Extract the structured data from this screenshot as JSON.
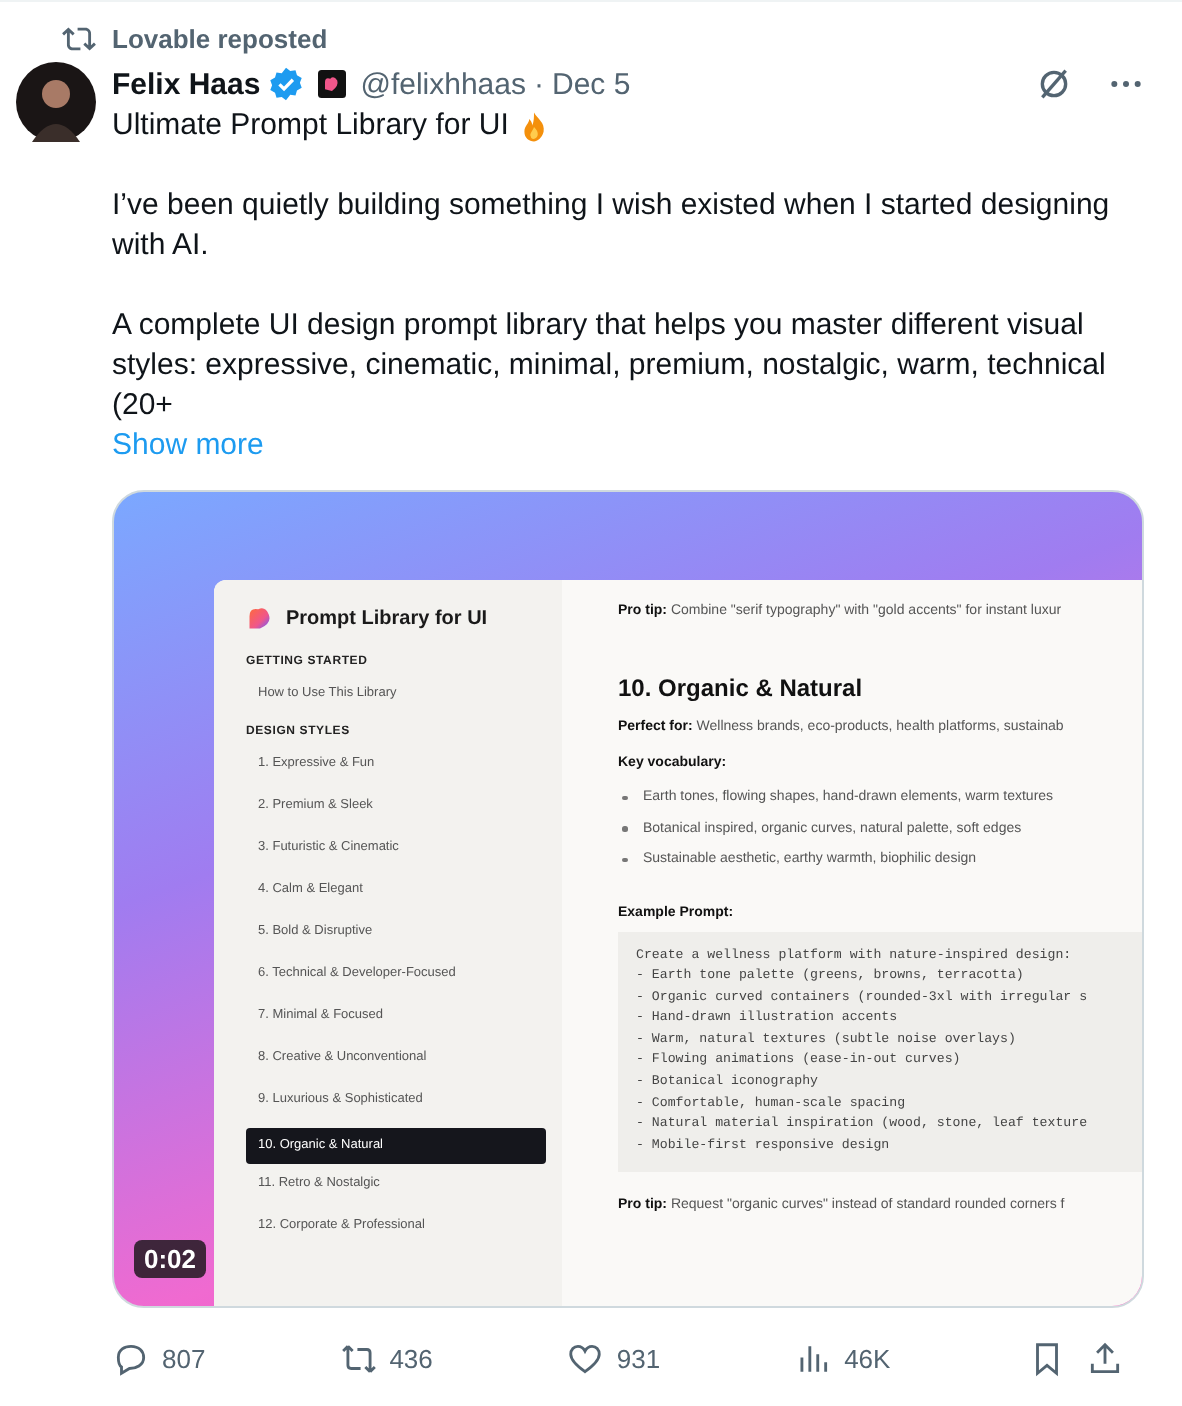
{
  "repost": {
    "label": "Lovable reposted"
  },
  "author": {
    "name": "Felix Haas",
    "verified": true,
    "handle": "@felixhhaas",
    "separator": "·",
    "date": "Dec 5"
  },
  "post": {
    "title": "Ultimate Prompt Library for UI",
    "paragraphs": [
      "I’ve been quietly building something I wish existed when I started designing with AI.",
      "A complete UI design prompt library that helps you master different visual styles: expressive, cinematic, minimal, premium, nostalgic, warm, technical (20+"
    ],
    "show_more": "Show more"
  },
  "video": {
    "duration": "0:02",
    "app": {
      "title": "Prompt Library for UI",
      "sections": [
        {
          "heading": "GETTING STARTED",
          "items": [
            {
              "label": "How to Use This Library",
              "selected": false
            }
          ]
        },
        {
          "heading": "DESIGN STYLES",
          "items": [
            {
              "label": "1. Expressive & Fun",
              "selected": false
            },
            {
              "label": "2. Premium & Sleek",
              "selected": false
            },
            {
              "label": "3. Futuristic & Cinematic",
              "selected": false
            },
            {
              "label": "4. Calm & Elegant",
              "selected": false
            },
            {
              "label": "5. Bold & Disruptive",
              "selected": false
            },
            {
              "label": "6. Technical & Developer-Focused",
              "selected": false
            },
            {
              "label": "7. Minimal & Focused",
              "selected": false
            },
            {
              "label": "8. Creative & Unconventional",
              "selected": false
            },
            {
              "label": "9. Luxurious & Sophisticated",
              "selected": false
            },
            {
              "label": "10. Organic & Natural",
              "selected": true
            },
            {
              "label": "11. Retro & Nostalgic",
              "selected": false
            },
            {
              "label": "12. Corporate & Professional",
              "selected": false
            }
          ]
        }
      ],
      "top_tip": "**Pro tip:** Combine \"serif typography\" with \"gold accents\" for instant luxur",
      "heading": "10. Organic & Natural",
      "perfect_for": "**Perfect for:** Wellness brands, eco-products, health platforms, sustainab",
      "vocabulary_heading": "Key vocabulary:",
      "vocabulary": [
        "Earth tones, flowing shapes, hand-drawn elements, warm textures",
        "Botanical inspired, organic curves, natural palette, soft edges",
        "Sustainable aesthetic, earthy warmth, biophilic design"
      ],
      "example_heading": "Example Prompt:",
      "code": [
        "Create a wellness platform with nature-inspired design:",
        "- Earth tone palette (greens, browns, terracotta)",
        "- Organic curved containers (rounded-3xl with irregular s",
        "- Hand-drawn illustration accents",
        "- Warm, natural textures (subtle noise overlays)",
        "- Flowing animations (ease-in-out curves)",
        "- Botanical iconography",
        "- Comfortable, human-scale spacing",
        "- Natural material inspiration (wood, stone, leaf texture",
        "- Mobile-first responsive design"
      ],
      "bottom_tip": "**Pro tip:** Request \"organic curves\" instead of standard rounded corners f"
    }
  },
  "actions": [
    {
      "kind": "reply",
      "count": "807"
    },
    {
      "kind": "repost",
      "count": "436"
    },
    {
      "kind": "like",
      "count": "931"
    },
    {
      "kind": "views",
      "count": "46K"
    },
    {
      "kind": "bookmark"
    },
    {
      "kind": "share"
    }
  ]
}
